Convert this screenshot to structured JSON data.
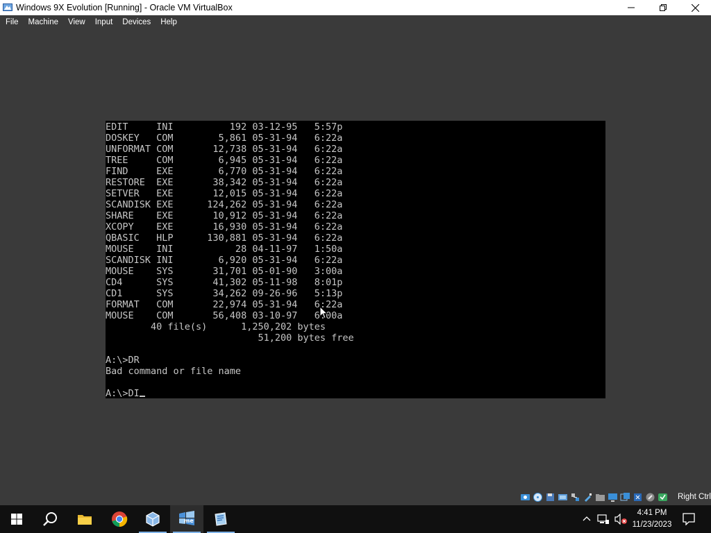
{
  "window": {
    "title": "Windows 9X Evolution [Running] - Oracle VM VirtualBox"
  },
  "menu": {
    "items": [
      "File",
      "Machine",
      "View",
      "Input",
      "Devices",
      "Help"
    ]
  },
  "dos": {
    "lines": [
      "EDIT     INI          192 03-12-95   5:57p",
      "DOSKEY   COM        5,861 05-31-94   6:22a",
      "UNFORMAT COM       12,738 05-31-94   6:22a",
      "TREE     COM        6,945 05-31-94   6:22a",
      "FIND     EXE        6,770 05-31-94   6:22a",
      "RESTORE  EXE       38,342 05-31-94   6:22a",
      "SETVER   EXE       12,015 05-31-94   6:22a",
      "SCANDISK EXE      124,262 05-31-94   6:22a",
      "SHARE    EXE       10,912 05-31-94   6:22a",
      "XCOPY    EXE       16,930 05-31-94   6:22a",
      "QBASIC   HLP      130,881 05-31-94   6:22a",
      "MOUSE    INI           28 04-11-97   1:50a",
      "SCANDISK INI        6,920 05-31-94   6:22a",
      "MOUSE    SYS       31,701 05-01-90   3:00a",
      "CD4      SYS       41,302 05-11-98   8:01p",
      "CD1      SYS       34,262 09-26-96   5:13p",
      "FORMAT   COM       22,974 05-31-94   6:22a",
      "MOUSE    COM       56,408 03-10-97   6:00a",
      "        40 file(s)      1,250,202 bytes",
      "                           51,200 bytes free",
      "",
      "A:\\>DR",
      "Bad command or file name",
      "",
      "A:\\>DI"
    ]
  },
  "statusbar": {
    "host_key": "Right Ctrl",
    "icons": [
      "hard-disk-icon",
      "optical-disk-icon",
      "floppy-disk-icon",
      "audio-icon",
      "network-icon",
      "usb-icon",
      "shared-folders-icon",
      "display-icon",
      "video-capture-icon",
      "recording-icon",
      "mouse-integration-icon",
      "keyboard-icon"
    ]
  },
  "taskbar": {
    "apps": [
      "start-button",
      "search-button",
      "file-explorer",
      "chrome",
      "virtualbox",
      "windows-me-vm",
      "virtualbox-manager"
    ]
  },
  "tray": {
    "time": "4:41 PM",
    "date": "11/23/2023"
  },
  "colors": {
    "vm_background": "#3a3a3a",
    "dos_text": "#c6c6c6",
    "taskbar": "#101010",
    "accent": "#7fb3e8"
  }
}
